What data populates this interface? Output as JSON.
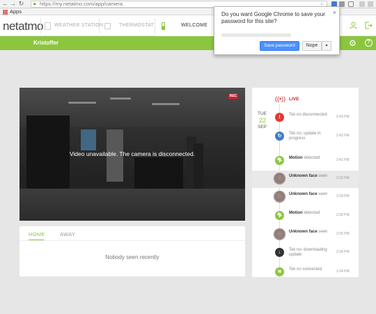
{
  "browser": {
    "url": "https://my.netatmo.com/app/camera",
    "bookmarks_label": "Apps"
  },
  "header": {
    "logo_net": "net",
    "logo_atmo": "atmo",
    "tabs": [
      {
        "label": "WEATHER STATION"
      },
      {
        "label": "THERMOSTAT"
      },
      {
        "label": "WELCOME"
      }
    ],
    "home_name": "Kristoffer"
  },
  "password_popup": {
    "question": "Do you want Google Chrome to save your password for this site?",
    "save_label": "Save password",
    "nope_label": "Nope"
  },
  "camera": {
    "rec_label": "REC",
    "message": "Video unavailable. The camera is disconnected."
  },
  "presence": {
    "tabs": [
      {
        "label": "HOME"
      },
      {
        "label": "AWAY"
      }
    ],
    "empty_message": "Nobody seen recently"
  },
  "timeline": {
    "live_label": "LIVE",
    "date": {
      "weekday": "TUE",
      "day": "22",
      "month": "SEP"
    },
    "events": [
      {
        "bold": "",
        "text": "Tek no disconnected",
        "time": "2:43 PM",
        "icon": "alert-icon",
        "color": "#e53935"
      },
      {
        "bold": "",
        "text": "Tek no: update in progress",
        "time": "2:42 PM",
        "icon": "update-icon",
        "color": "#3f7fc4"
      },
      {
        "bold": "Motion",
        "text": " detected",
        "time": "2:41 PM",
        "icon": "motion-icon",
        "color": "#8cc63f"
      },
      {
        "bold": "Unknown face",
        "text": " seen",
        "time": "2:39 PM",
        "icon": "face-thumbnail",
        "color": "",
        "selected": true
      },
      {
        "bold": "Unknown face",
        "text": " seen",
        "time": "2:39 PM",
        "icon": "face-thumbnail",
        "color": ""
      },
      {
        "bold": "Motion",
        "text": " detected",
        "time": "2:36 PM",
        "icon": "motion-icon",
        "color": "#8cc63f"
      },
      {
        "bold": "Unknown face",
        "text": " seen",
        "time": "2:35 PM",
        "icon": "face-thumbnail",
        "color": ""
      },
      {
        "bold": "",
        "text": "Tek no: downloading update",
        "time": "2:34 PM",
        "icon": "download-icon",
        "color": "#333333"
      },
      {
        "bold": "",
        "text": "Tek no connected",
        "time": "2:34 PM",
        "icon": "wifi-icon",
        "color": "#8cc63f"
      }
    ]
  },
  "colors": {
    "accent": "#8cc63f",
    "live_red": "#d0202a",
    "button_blue": "#4d90fe"
  }
}
